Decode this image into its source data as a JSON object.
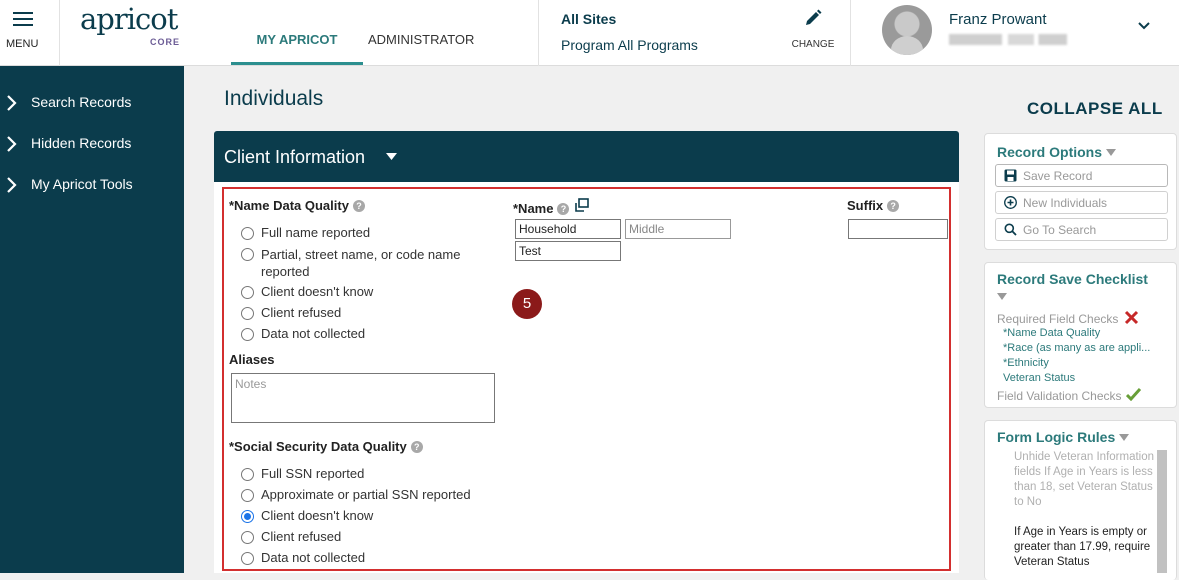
{
  "header": {
    "menu_label": "MENU",
    "logo_text": "apricot",
    "logo_sub": "CORE",
    "tabs": [
      {
        "label": "MY APRICOT"
      },
      {
        "label": "ADMINISTRATOR"
      }
    ],
    "sites_title": "All Sites",
    "sites_sub": "Program All Programs",
    "change_label": "CHANGE",
    "user_name": "Franz Prowant"
  },
  "sidebar": {
    "items": [
      {
        "label": "Search Records"
      },
      {
        "label": "Hidden Records"
      },
      {
        "label": "My Apricot Tools"
      }
    ]
  },
  "main": {
    "page_title": "Individuals",
    "section_title": "Client Information",
    "name_dq": {
      "label": "*Name Data Quality",
      "options": [
        {
          "label": "Full name reported",
          "checked": false
        },
        {
          "label": "Partial, street name, or code name reported",
          "checked": false
        },
        {
          "label": "Client doesn't know",
          "checked": false
        },
        {
          "label": "Client refused",
          "checked": false
        },
        {
          "label": "Data not collected",
          "checked": false
        }
      ]
    },
    "name": {
      "label": "*Name",
      "first_value": "Household",
      "middle_placeholder": "Middle",
      "last_value": "Test"
    },
    "suffix": {
      "label": "Suffix",
      "value": ""
    },
    "aliases": {
      "label": "Aliases",
      "placeholder": "Notes"
    },
    "ssn_dq": {
      "label": "*Social Security Data Quality",
      "options": [
        {
          "label": "Full SSN reported",
          "checked": false
        },
        {
          "label": "Approximate or partial SSN reported",
          "checked": false
        },
        {
          "label": "Client doesn't know",
          "checked": true
        },
        {
          "label": "Client refused",
          "checked": false
        },
        {
          "label": "Data not collected",
          "checked": false
        }
      ]
    },
    "step_badge": "5"
  },
  "right": {
    "collapse_all": "COLLAPSE ALL",
    "record_options": {
      "title": "Record Options",
      "buttons": [
        {
          "label": "Save Record",
          "icon": "save-icon"
        },
        {
          "label": "New Individuals",
          "icon": "plus-circle-icon"
        },
        {
          "label": "Go To Search",
          "icon": "search-icon"
        }
      ]
    },
    "checklist": {
      "title": "Record Save Checklist",
      "required_label": "Required Field Checks",
      "items": [
        "*Name Data Quality",
        "*Race (as many as are appli...",
        "*Ethnicity",
        "Veteran Status"
      ],
      "validation_label": "Field Validation Checks"
    },
    "form_logic": {
      "title": "Form Logic Rules",
      "rule_inactive": "Unhide Veteran Information fields If Age in Years is less than 18, set Veteran Status to No",
      "rule_active": "If Age in Years is empty or greater than 17.99, require Veteran Status"
    }
  },
  "colors": {
    "primary": "#0b3c4c",
    "accent": "#2c7a7b",
    "highlight_border": "#d32f2f",
    "badge": "#8b1a1a",
    "radio_checked": "#1a73e8"
  }
}
